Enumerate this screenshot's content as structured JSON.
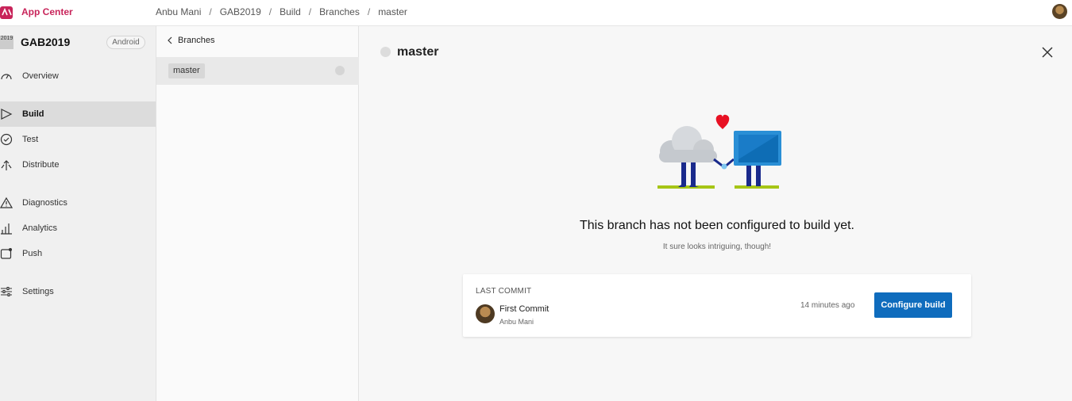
{
  "header": {
    "brand": "App Center",
    "breadcrumbs": [
      "Anbu Mani",
      "Build",
      "Branches",
      "master"
    ],
    "breadcrumb_app": "GAB2019"
  },
  "sidebar": {
    "app_icon_text": "2019",
    "app_name": "GAB2019",
    "platform": "Android",
    "items": [
      {
        "label": "Overview",
        "icon": "speedometer-icon"
      },
      {
        "label": "Build",
        "icon": "play-outline-icon",
        "active": true
      },
      {
        "label": "Test",
        "icon": "check-circle-icon"
      },
      {
        "label": "Distribute",
        "icon": "distribute-icon"
      },
      {
        "label": "Diagnostics",
        "icon": "warning-triangle-icon"
      },
      {
        "label": "Analytics",
        "icon": "bar-chart-icon"
      },
      {
        "label": "Push",
        "icon": "push-notification-icon"
      },
      {
        "label": "Settings",
        "icon": "sliders-icon"
      }
    ]
  },
  "branches": {
    "back_label": "Branches",
    "list": [
      {
        "name": "master"
      }
    ]
  },
  "detail": {
    "title": "master",
    "headline": "This branch has not been configured to build yet.",
    "subline": "It sure looks intriguing, though!",
    "last_commit": {
      "label": "LAST COMMIT",
      "message": "First Commit",
      "author": "Anbu Mani",
      "time": "14 minutes ago"
    },
    "configure_label": "Configure build"
  },
  "colors": {
    "brand": "#c8245a",
    "primary_button": "#0f6cbd"
  }
}
